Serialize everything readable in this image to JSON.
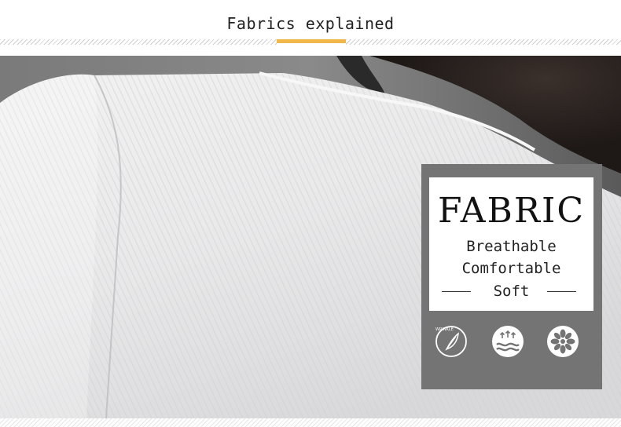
{
  "header": {
    "title": "Fabrics explained",
    "accent_color": "#f0b84a"
  },
  "photo": {
    "description_icon": "knit-sweater-photo"
  },
  "fabric_panel": {
    "heading": "FABRIC",
    "features": [
      "Breathable",
      "Comfortable",
      "Soft"
    ],
    "panel_color": "#747474",
    "icons": [
      {
        "name": "wrinkle-resistant-icon",
        "label": "WRINKLE"
      },
      {
        "name": "breathable-icon"
      },
      {
        "name": "soft-flower-icon"
      }
    ]
  }
}
